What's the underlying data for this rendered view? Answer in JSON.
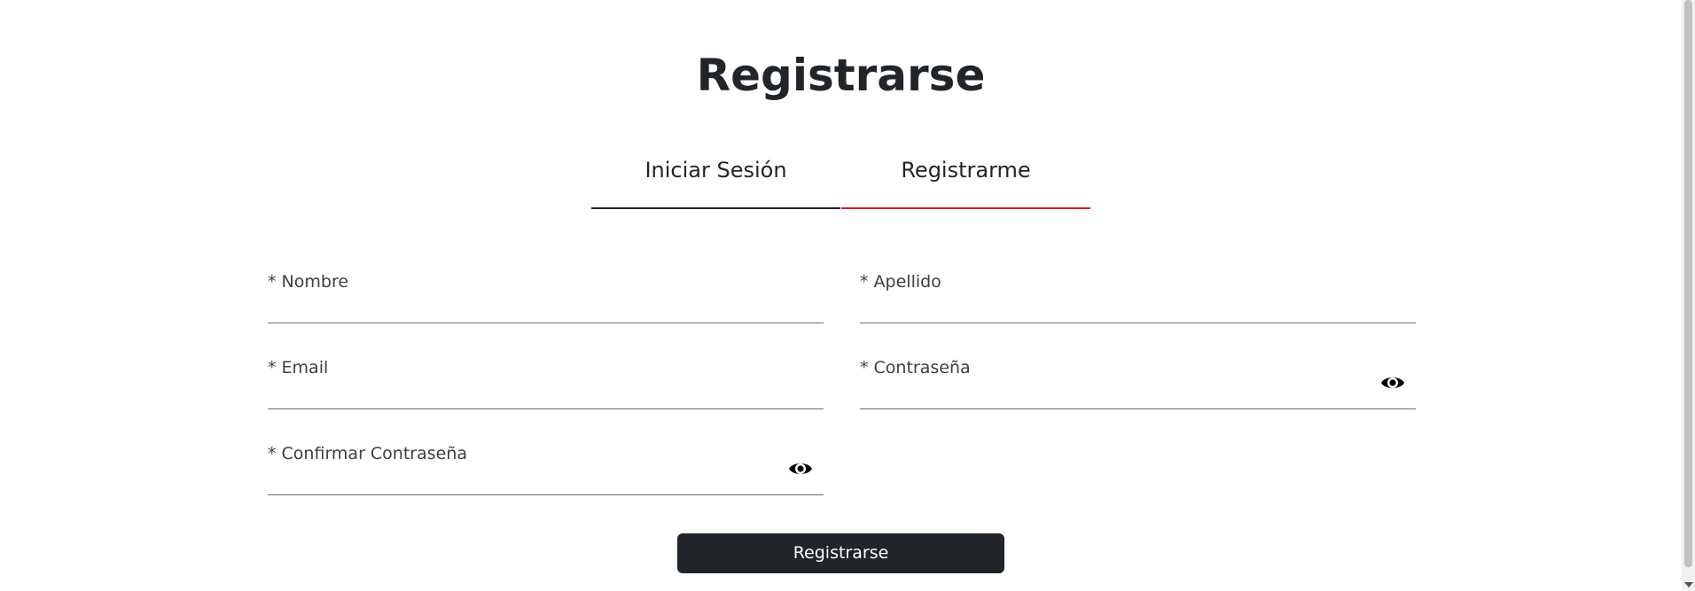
{
  "page": {
    "title": "Registrarse"
  },
  "tabs": [
    {
      "label": "Iniciar Sesión",
      "active": false
    },
    {
      "label": "Registrarme",
      "active": true
    }
  ],
  "form": {
    "fields": {
      "nombre": {
        "label": "* Nombre",
        "value": ""
      },
      "apellido": {
        "label": "* Apellido",
        "value": ""
      },
      "email": {
        "label": "* Email",
        "value": ""
      },
      "contrasena": {
        "label": "* Contraseña",
        "value": "",
        "icon": "eye-icon"
      },
      "confirmar": {
        "label": "* Confirmar Contraseña",
        "value": "",
        "icon": "eye-icon"
      }
    },
    "submit_label": "Registrarse"
  },
  "colors": {
    "accent": "#d21f26",
    "dark": "#212529",
    "background": "#ffffff"
  }
}
